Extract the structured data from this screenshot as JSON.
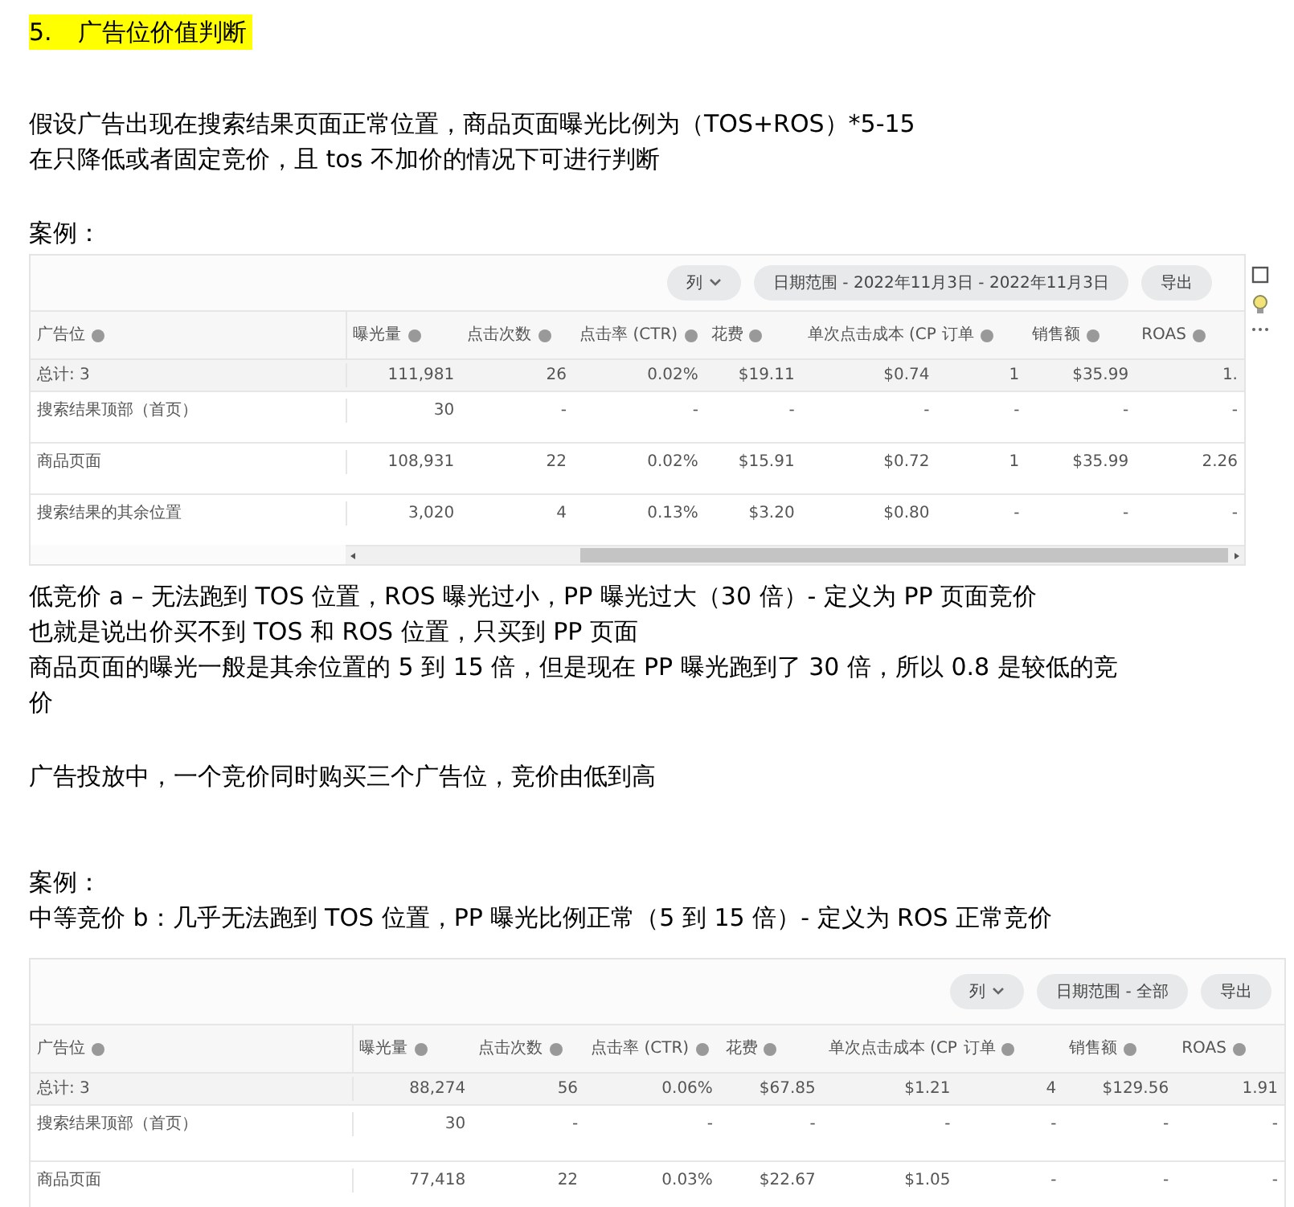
{
  "content": [
    {
      "kind": "heading",
      "number": "5.",
      "text": "广告位价值判断"
    },
    {
      "kind": "paragraph",
      "lines": [
        "假设广告出现在搜索结果页面正常位置，商品页面曝光比例为（TOS+ROS）*5-15",
        "在只降低或者固定竞价，且 tos 不加价的情况下可进行判断"
      ]
    },
    {
      "kind": "paragraph",
      "lines": [
        "案例："
      ]
    },
    {
      "kind": "table",
      "buttons": [
        {
          "label": "列",
          "dropdown": true
        },
        {
          "label": "日期范围 - 2022年11月3日 - 2022年11月3日",
          "dropdown": false
        },
        {
          "label": "导出",
          "dropdown": false
        }
      ],
      "side_tools": true,
      "scrollbar": true,
      "columns": [
        {
          "label": "广告位",
          "info": true
        },
        {
          "label": "曝光量",
          "info": true
        },
        {
          "label": "点击次数",
          "info": true
        },
        {
          "label": "点击率 (CTR)",
          "info": true
        },
        {
          "label": "花费",
          "info": true
        },
        {
          "label": "单次点击成本 (CP",
          "info": false
        },
        {
          "label": "订单",
          "info": true
        },
        {
          "label": "销售额",
          "info": true
        },
        {
          "label": "ROAS",
          "info": true
        }
      ],
      "rows": [
        {
          "total": true,
          "cells": [
            "总计: 3",
            "111,981",
            "26",
            "0.02%",
            "$19.11",
            "$0.74",
            "1",
            "$35.99",
            "1."
          ]
        },
        {
          "total": false,
          "cells": [
            "搜索结果顶部（首页）",
            "30",
            "-",
            "-",
            "-",
            "-",
            "-",
            "-",
            "-"
          ]
        },
        {
          "total": false,
          "cells": [
            "商品页面",
            "108,931",
            "22",
            "0.02%",
            "$15.91",
            "$0.72",
            "1",
            "$35.99",
            "2.26"
          ]
        },
        {
          "total": false,
          "cells": [
            "搜索结果的其余位置",
            "3,020",
            "4",
            "0.13%",
            "$3.20",
            "$0.80",
            "-",
            "-",
            "-"
          ]
        }
      ]
    },
    {
      "kind": "paragraph",
      "lines": [
        "低竞价 a – 无法跑到 TOS 位置，ROS 曝光过小，PP 曝光过大（30 倍）- 定义为 PP 页面竞价",
        "也就是说出价买不到 TOS 和 ROS 位置，只买到 PP 页面",
        "商品页面的曝光一般是其余位置的 5 到 15 倍，但是现在 PP 曝光跑到了 30 倍，所以 0.8 是较低的竞价"
      ]
    },
    {
      "kind": "paragraph",
      "lines": [
        "广告投放中，一个竞价同时购买三个广告位，竞价由低到高"
      ]
    },
    {
      "kind": "paragraph",
      "lines": [
        "案例：",
        "中等竞价 b：几乎无法跑到 TOS 位置，PP 曝光比例正常（5 到 15 倍）- 定义为 ROS 正常竞价"
      ]
    },
    {
      "kind": "table",
      "buttons": [
        {
          "label": "列",
          "dropdown": true
        },
        {
          "label": "日期范围 - 全部",
          "dropdown": false
        },
        {
          "label": "导出",
          "dropdown": false
        }
      ],
      "side_tools": false,
      "scrollbar": false,
      "columns": [
        {
          "label": "广告位",
          "info": true
        },
        {
          "label": "曝光量",
          "info": true
        },
        {
          "label": "点击次数",
          "info": true
        },
        {
          "label": "点击率 (CTR)",
          "info": true
        },
        {
          "label": "花费",
          "info": true
        },
        {
          "label": "单次点击成本 (CP",
          "info": false
        },
        {
          "label": "订单",
          "info": true
        },
        {
          "label": "销售额",
          "info": true
        },
        {
          "label": "ROAS",
          "info": true
        }
      ],
      "rows": [
        {
          "total": true,
          "cells": [
            "总计: 3",
            "88,274",
            "56",
            "0.06%",
            "$67.85",
            "$1.21",
            "4",
            "$129.56",
            "1.91"
          ]
        },
        {
          "total": false,
          "cells": [
            "搜索结果顶部（首页）",
            "30",
            "-",
            "-",
            "-",
            "-",
            "-",
            "-",
            "-"
          ]
        },
        {
          "total": false,
          "cells": [
            "商品页面",
            "77,418",
            "22",
            "0.03%",
            "$22.67",
            "$1.05",
            "-",
            "-",
            "-"
          ]
        }
      ]
    }
  ]
}
